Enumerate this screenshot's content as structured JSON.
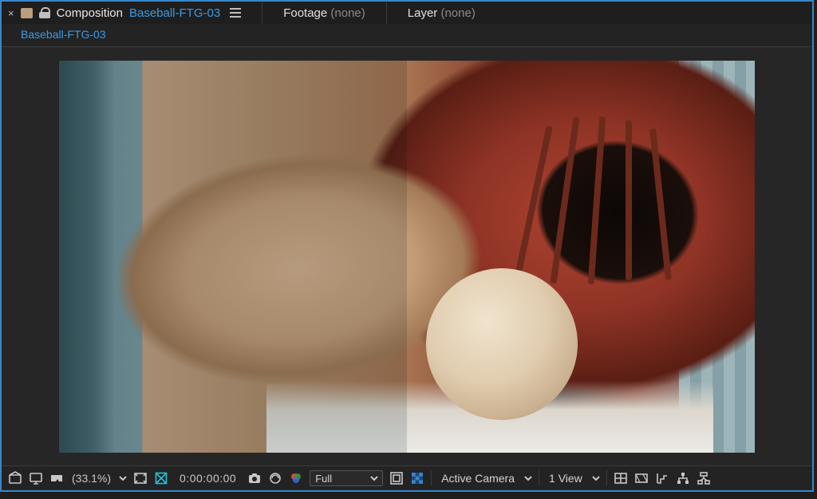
{
  "top": {
    "panel_label": "Composition",
    "comp_name": "Baseball-FTG-03",
    "footage_label": "Footage",
    "footage_value": "(none)",
    "layer_label": "Layer",
    "layer_value": "(none)"
  },
  "tab": {
    "name": "Baseball-FTG-03"
  },
  "viewer": {
    "description": "Split-view preview: hands holding a baseball inside a red baseball glove; left half has muted/cooler grade, right half is warmer/saturated."
  },
  "controls": {
    "zoom_percent": "(33.1%)",
    "timecode": "0:00:00:00",
    "resolution": "Full",
    "camera": "Active Camera",
    "views": "1 View"
  }
}
